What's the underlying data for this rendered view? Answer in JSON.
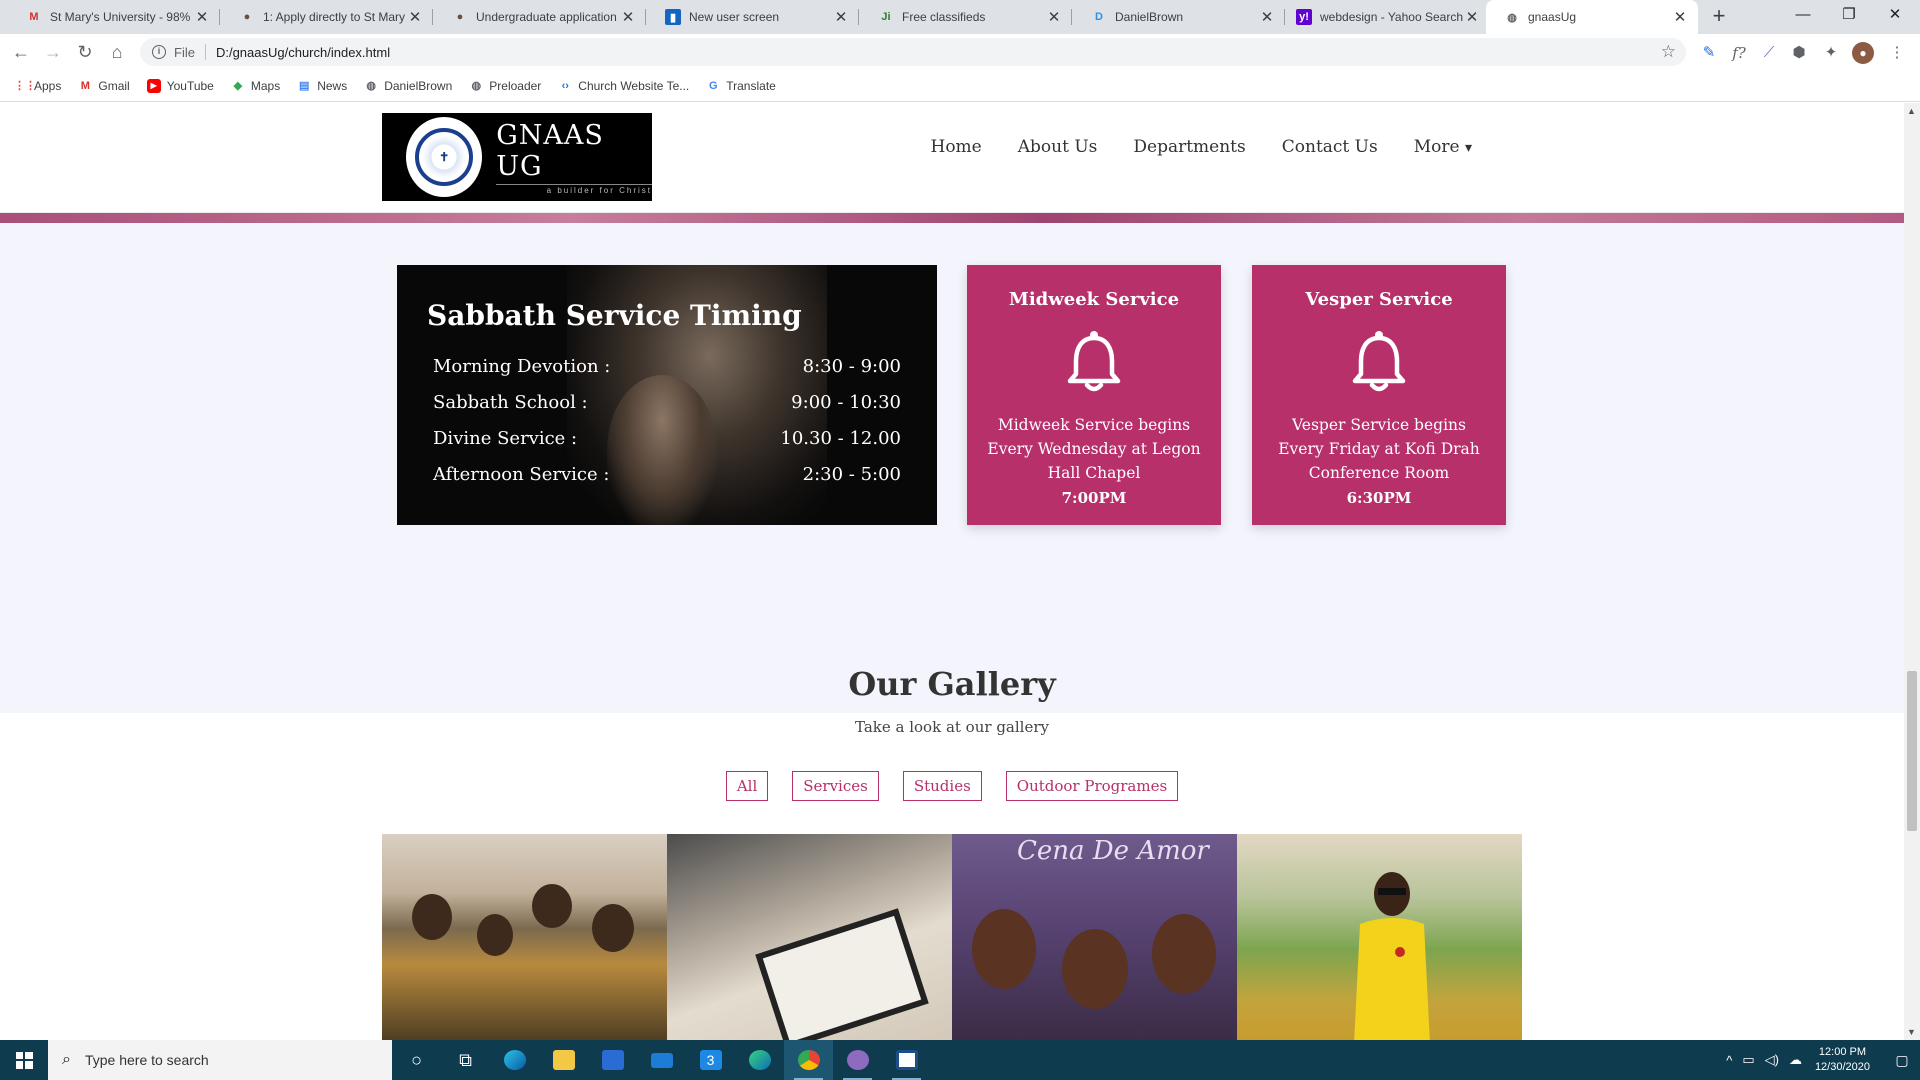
{
  "browser": {
    "tabs": [
      {
        "label": "St Mary's University - 98% g",
        "icon": "gmail-icon",
        "color": "#d93025"
      },
      {
        "label": "1: Apply directly to St Mary",
        "icon": "page-icon",
        "color": "#6d4c41"
      },
      {
        "label": "Undergraduate application",
        "icon": "page-icon",
        "color": "#6d4c41"
      },
      {
        "label": "New user screen",
        "icon": "trello-icon",
        "color": "#1565c0"
      },
      {
        "label": "Free classifieds",
        "icon": "jiji-icon",
        "color": "#2e7d32"
      },
      {
        "label": "DanielBrown",
        "icon": "d-icon",
        "color": "#2196f3"
      },
      {
        "label": "webdesign - Yahoo Search",
        "icon": "yahoo-icon",
        "color": "#5f01d1"
      },
      {
        "label": "gnaasUg",
        "icon": "globe-icon",
        "color": "#5f6368",
        "active": true
      }
    ],
    "address": {
      "scheme": "File",
      "url": "D:/gnaasUg/church/index.html"
    },
    "bookmarks": [
      {
        "label": "Apps",
        "icon": "apps-grid-icon",
        "color": "#e8453c"
      },
      {
        "label": "Gmail",
        "icon": "gmail-icon",
        "color": "#d93025"
      },
      {
        "label": "YouTube",
        "icon": "youtube-icon",
        "color": "#ff0000"
      },
      {
        "label": "Maps",
        "icon": "maps-icon",
        "color": "#34a853"
      },
      {
        "label": "News",
        "icon": "news-icon",
        "color": "#4285f4"
      },
      {
        "label": "DanielBrown",
        "icon": "globe-icon",
        "color": "#5f6368"
      },
      {
        "label": "Preloader",
        "icon": "globe-icon",
        "color": "#5f6368"
      },
      {
        "label": "Church Website Te...",
        "icon": "code-icon",
        "color": "#1a73e8"
      },
      {
        "label": "Translate",
        "icon": "translate-icon",
        "color": "#4285f4"
      }
    ]
  },
  "site": {
    "logo": {
      "name": "GNAAS UG",
      "tagline": "a builder for Christ"
    },
    "nav": [
      "Home",
      "About Us",
      "Departments",
      "Contact Us",
      "More"
    ],
    "nav_more_caret": "▾",
    "sabbath": {
      "title": "Sabbath Service Timing",
      "rows": [
        {
          "label": "Morning Devotion :",
          "time": "8:30 - 9:00"
        },
        {
          "label": "Sabbath School :",
          "time": "9:00 - 10:30"
        },
        {
          "label": "Divine Service :",
          "time": "10.30 - 12.00"
        },
        {
          "label": "Afternoon Service :",
          "time": "2:30 - 5:00"
        }
      ]
    },
    "cards": [
      {
        "title": "Midweek Service",
        "desc": "Midweek Service begins Every Wednesday at Legon Hall Chapel",
        "time": "7:00PM"
      },
      {
        "title": "Vesper Service",
        "desc": "Vesper Service begins Every Friday at Kofi Drah Conference Room",
        "time": "6:30PM"
      }
    ],
    "gallery": {
      "title": "Our Gallery",
      "subtitle": "Take a look at our gallery",
      "filters": [
        "All",
        "Services",
        "Studies",
        "Outdoor Programes"
      ],
      "image3_caption": "Cena De Amor"
    }
  },
  "taskbar": {
    "search_placeholder": "Type here to search",
    "time": "12:00 PM",
    "date": "12/30/2020"
  },
  "colors": {
    "accent": "#b7306a",
    "taskbar": "#0f3b4f"
  }
}
